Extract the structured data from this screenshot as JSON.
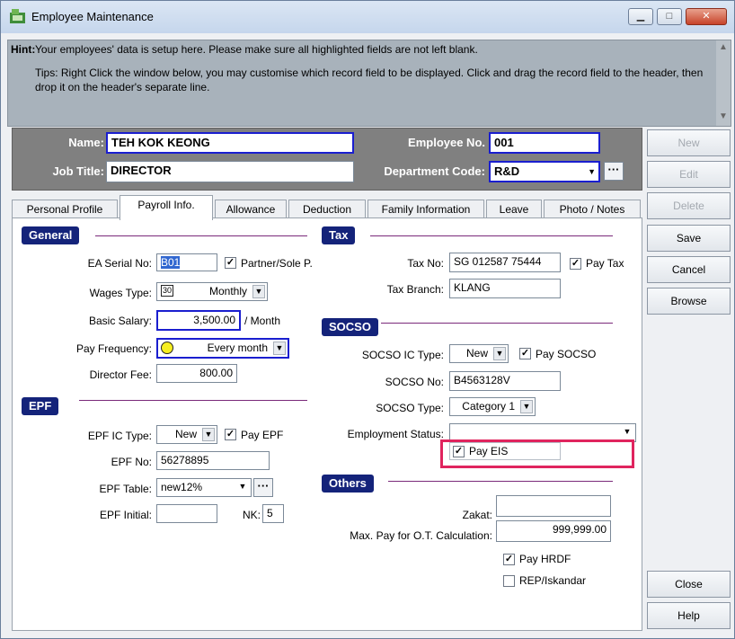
{
  "window": {
    "title": "Employee Maintenance",
    "controls": [
      "▁",
      "□",
      "✕"
    ]
  },
  "hint": {
    "label": "Hint:",
    "line1": "Your employees' data is setup here. Please make sure all highlighted fields are not left blank.",
    "line2": "Tips: Right Click the window below, you may customise which record field to be displayed. Click and drag the record field to the header, then drop it on the header's separate line."
  },
  "header": {
    "name_label": "Name:",
    "name_value": "TEH KOK KEONG",
    "job_label": "Job Title:",
    "job_value": "DIRECTOR",
    "empno_label": "Employee No.",
    "empno_value": "001",
    "dept_label": "Department Code:",
    "dept_value": "R&D"
  },
  "tabs": [
    "Personal Profile",
    "Payroll Info.",
    "Allowance",
    "Deduction",
    "Family Information",
    "Leave",
    "Photo / Notes"
  ],
  "general": {
    "title": "General",
    "ea_label": "EA Serial No:",
    "ea_value": "B01",
    "partner_label": "Partner/Sole P.",
    "wages_label": "Wages Type:",
    "wages_code": "30",
    "wages_value": "Monthly",
    "salary_label": "Basic Salary:",
    "salary_value": "3,500.00",
    "salary_unit": "/ Month",
    "freq_label": "Pay Frequency:",
    "freq_value": "Every month",
    "director_label": "Director Fee:",
    "director_value": "800.00"
  },
  "epf": {
    "title": "EPF",
    "ic_label": "EPF IC Type:",
    "ic_value": "New",
    "pay_label": "Pay EPF",
    "no_label": "EPF No:",
    "no_value": "56278895",
    "table_label": "EPF Table:",
    "table_value": "new12%",
    "initial_label": "EPF Initial:",
    "initial_value": "",
    "nk_label": "NK:",
    "nk_value": "5"
  },
  "tax": {
    "title": "Tax",
    "no_label": "Tax No:",
    "no_value": "SG 012587 75444",
    "pay_label": "Pay Tax",
    "branch_label": "Tax Branch:",
    "branch_value": "KLANG"
  },
  "socso": {
    "title": "SOCSO",
    "ic_label": "SOCSO IC Type:",
    "ic_value": "New",
    "pay_label": "Pay SOCSO",
    "no_label": "SOCSO No:",
    "no_value": "B4563128V",
    "type_label": "SOCSO Type:",
    "type_value": "Category 1",
    "status_label": "Employment Status:",
    "status_value": "",
    "eis_label": "Pay EIS"
  },
  "others": {
    "title": "Others",
    "zakat_label": "Zakat:",
    "zakat_value": "",
    "maxpay_label": "Max. Pay for O.T. Calculation:",
    "maxpay_value": "999,999.00",
    "hrdf_label": "Pay HRDF",
    "rep_label": "REP/Iskandar"
  },
  "buttons": {
    "new": "New",
    "edit": "Edit",
    "delete": "Delete",
    "save": "Save",
    "cancel": "Cancel",
    "browse": "Browse",
    "close": "Close",
    "help": "Help"
  },
  "colors": {
    "highlight_box": "#e0245e",
    "section_bg": "#14237a",
    "required_border": "#1a1ecf"
  }
}
